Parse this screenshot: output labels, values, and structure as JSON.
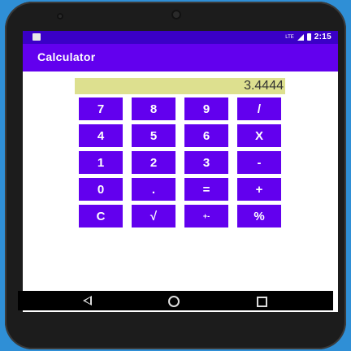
{
  "status_bar": {
    "network_label": "LTE",
    "time": "2:15"
  },
  "app_bar": {
    "title": "Calculator"
  },
  "display": {
    "value": "3.4444"
  },
  "keypad": {
    "rows": [
      [
        "7",
        "8",
        "9",
        "/"
      ],
      [
        "4",
        "5",
        "6",
        "X"
      ],
      [
        "1",
        "2",
        "3",
        "-"
      ],
      [
        "0",
        ".",
        "=",
        "+"
      ],
      [
        "C",
        "√",
        "+-",
        "%"
      ]
    ]
  },
  "colors": {
    "status_bar": "#3a00c7",
    "app_bar": "#6200ee",
    "button": "#6200ee",
    "display_bg": "#dde08f",
    "outer_bg": "#2f8fd6"
  },
  "nav_icons": [
    "back-icon",
    "home-icon",
    "recent-apps-icon"
  ]
}
